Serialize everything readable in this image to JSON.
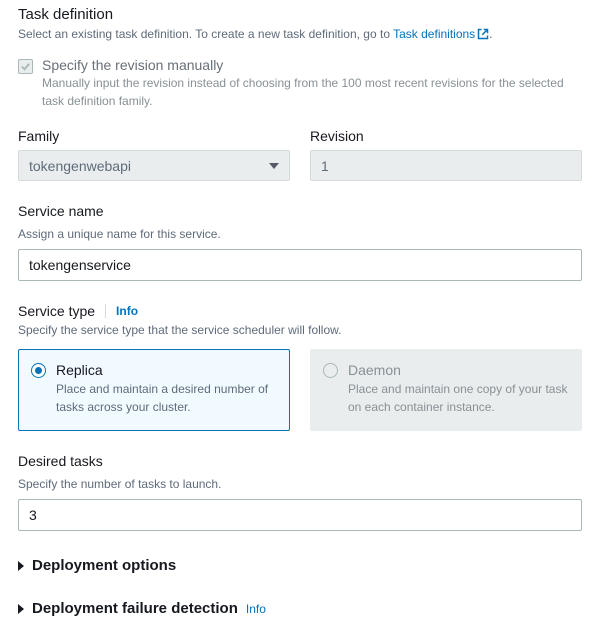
{
  "task_definition": {
    "title": "Task definition",
    "desc_prefix": "Select an existing task definition. To create a new task definition, go to ",
    "link_text": "Task definitions",
    "desc_suffix": "."
  },
  "specify_revision": {
    "label": "Specify the revision manually",
    "desc": "Manually input the revision instead of choosing from the 100 most recent revisions for the selected task definition family."
  },
  "family": {
    "label": "Family",
    "value": "tokengenwebapi"
  },
  "revision": {
    "label": "Revision",
    "value": "1"
  },
  "service_name": {
    "label": "Service name",
    "desc": "Assign a unique name for this service.",
    "value": "tokengenservice"
  },
  "service_type": {
    "label": "Service type",
    "info": "Info",
    "desc": "Specify the service type that the service scheduler will follow.",
    "replica": {
      "title": "Replica",
      "desc": "Place and maintain a desired number of tasks across your cluster."
    },
    "daemon": {
      "title": "Daemon",
      "desc": "Place and maintain one copy of your task on each container instance."
    }
  },
  "desired_tasks": {
    "label": "Desired tasks",
    "desc": "Specify the number of tasks to launch.",
    "value": "3"
  },
  "expanders": {
    "deployment_options": "Deployment options",
    "deployment_failure": "Deployment failure detection",
    "info": "Info"
  }
}
